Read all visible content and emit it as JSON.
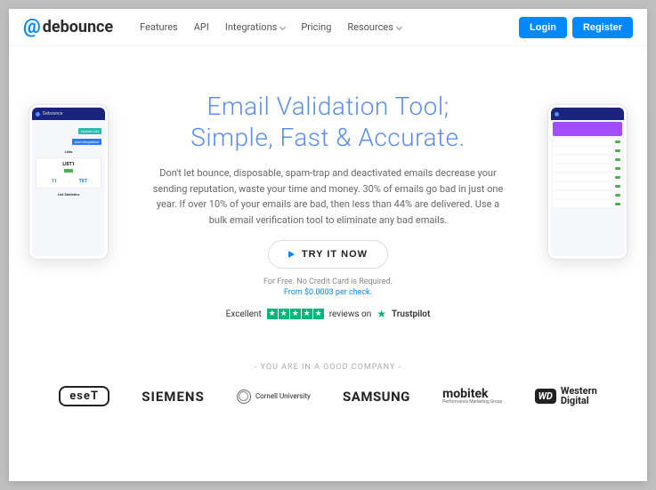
{
  "header": {
    "logo_text": "debounce",
    "nav": [
      {
        "label": "Features",
        "dropdown": false
      },
      {
        "label": "API",
        "dropdown": false
      },
      {
        "label": "Integrations",
        "dropdown": true
      },
      {
        "label": "Pricing",
        "dropdown": false
      },
      {
        "label": "Resources",
        "dropdown": true
      }
    ],
    "login": "Login",
    "register": "Register"
  },
  "hero": {
    "title_line1": "Email Validation Tool;",
    "title_line2": "Simple, Fast & Accurate.",
    "description": "Don't let bounce, disposable, spam-trap and deactivated emails decrease your sending reputation, waste your time and money. 30% of emails go bad in just one year. If over 10% of your emails are bad, then less than 44% are delivered. Use a bulk email verification tool to eliminate any bad emails.",
    "cta": "TRY IT NOW",
    "sub1": "For Free. No Credit Card is Required.",
    "sub2": "From $0.0003 per check.",
    "trust_prefix": "Excellent",
    "trust_suffix": "reviews on",
    "trust_brand": "Trustpilot"
  },
  "phone_left": {
    "product": "Debounce",
    "section": "Lists",
    "btn1": "Upload List",
    "btn2": "Add Integration",
    "card_title": "LIST1",
    "split1": "11",
    "split2": "TXT",
    "footer": "List Statistics"
  },
  "company": {
    "heading": "- YOU ARE IN A GOOD COMPANY -",
    "items": {
      "eset": "eseT",
      "siemens": "SIEMENS",
      "cornell": "Cornell University",
      "samsung": "SAMSUNG",
      "mobitek": "mobitek",
      "mobitek_sub": "Performance Marketing Group",
      "wd_box": "WD",
      "wd_line1": "Western",
      "wd_line2": "Digital"
    }
  }
}
